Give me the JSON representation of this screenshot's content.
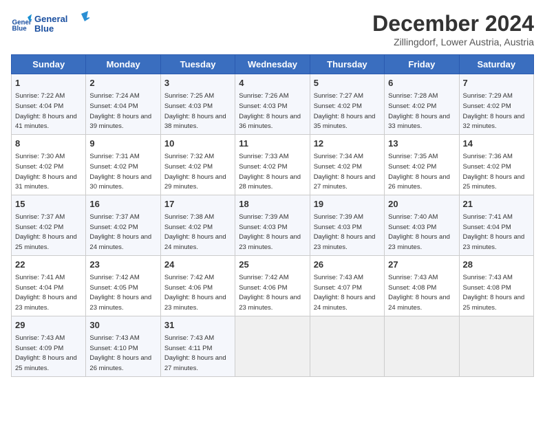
{
  "header": {
    "logo_line1": "General",
    "logo_line2": "Blue",
    "title": "December 2024",
    "subtitle": "Zillingdorf, Lower Austria, Austria"
  },
  "calendar": {
    "days_of_week": [
      "Sunday",
      "Monday",
      "Tuesday",
      "Wednesday",
      "Thursday",
      "Friday",
      "Saturday"
    ],
    "weeks": [
      [
        null,
        {
          "day": 2,
          "sunrise": "7:24 AM",
          "sunset": "4:04 PM",
          "daylight": "8 hours and 39 minutes."
        },
        {
          "day": 3,
          "sunrise": "7:25 AM",
          "sunset": "4:03 PM",
          "daylight": "8 hours and 38 minutes."
        },
        {
          "day": 4,
          "sunrise": "7:26 AM",
          "sunset": "4:03 PM",
          "daylight": "8 hours and 36 minutes."
        },
        {
          "day": 5,
          "sunrise": "7:27 AM",
          "sunset": "4:02 PM",
          "daylight": "8 hours and 35 minutes."
        },
        {
          "day": 6,
          "sunrise": "7:28 AM",
          "sunset": "4:02 PM",
          "daylight": "8 hours and 33 minutes."
        },
        {
          "day": 7,
          "sunrise": "7:29 AM",
          "sunset": "4:02 PM",
          "daylight": "8 hours and 32 minutes."
        }
      ],
      [
        {
          "day": 1,
          "sunrise": "7:22 AM",
          "sunset": "4:04 PM",
          "daylight": "8 hours and 41 minutes."
        },
        {
          "day": 9,
          "sunrise": "7:31 AM",
          "sunset": "4:02 PM",
          "daylight": "8 hours and 30 minutes."
        },
        {
          "day": 10,
          "sunrise": "7:32 AM",
          "sunset": "4:02 PM",
          "daylight": "8 hours and 29 minutes."
        },
        {
          "day": 11,
          "sunrise": "7:33 AM",
          "sunset": "4:02 PM",
          "daylight": "8 hours and 28 minutes."
        },
        {
          "day": 12,
          "sunrise": "7:34 AM",
          "sunset": "4:02 PM",
          "daylight": "8 hours and 27 minutes."
        },
        {
          "day": 13,
          "sunrise": "7:35 AM",
          "sunset": "4:02 PM",
          "daylight": "8 hours and 26 minutes."
        },
        {
          "day": 14,
          "sunrise": "7:36 AM",
          "sunset": "4:02 PM",
          "daylight": "8 hours and 25 minutes."
        }
      ],
      [
        {
          "day": 8,
          "sunrise": "7:30 AM",
          "sunset": "4:02 PM",
          "daylight": "8 hours and 31 minutes."
        },
        {
          "day": 16,
          "sunrise": "7:37 AM",
          "sunset": "4:02 PM",
          "daylight": "8 hours and 24 minutes."
        },
        {
          "day": 17,
          "sunrise": "7:38 AM",
          "sunset": "4:02 PM",
          "daylight": "8 hours and 24 minutes."
        },
        {
          "day": 18,
          "sunrise": "7:39 AM",
          "sunset": "4:03 PM",
          "daylight": "8 hours and 23 minutes."
        },
        {
          "day": 19,
          "sunrise": "7:39 AM",
          "sunset": "4:03 PM",
          "daylight": "8 hours and 23 minutes."
        },
        {
          "day": 20,
          "sunrise": "7:40 AM",
          "sunset": "4:03 PM",
          "daylight": "8 hours and 23 minutes."
        },
        {
          "day": 21,
          "sunrise": "7:41 AM",
          "sunset": "4:04 PM",
          "daylight": "8 hours and 23 minutes."
        }
      ],
      [
        {
          "day": 15,
          "sunrise": "7:37 AM",
          "sunset": "4:02 PM",
          "daylight": "8 hours and 25 minutes."
        },
        {
          "day": 23,
          "sunrise": "7:42 AM",
          "sunset": "4:05 PM",
          "daylight": "8 hours and 23 minutes."
        },
        {
          "day": 24,
          "sunrise": "7:42 AM",
          "sunset": "4:06 PM",
          "daylight": "8 hours and 23 minutes."
        },
        {
          "day": 25,
          "sunrise": "7:42 AM",
          "sunset": "4:06 PM",
          "daylight": "8 hours and 23 minutes."
        },
        {
          "day": 26,
          "sunrise": "7:43 AM",
          "sunset": "4:07 PM",
          "daylight": "8 hours and 24 minutes."
        },
        {
          "day": 27,
          "sunrise": "7:43 AM",
          "sunset": "4:08 PM",
          "daylight": "8 hours and 24 minutes."
        },
        {
          "day": 28,
          "sunrise": "7:43 AM",
          "sunset": "4:08 PM",
          "daylight": "8 hours and 25 minutes."
        }
      ],
      [
        {
          "day": 22,
          "sunrise": "7:41 AM",
          "sunset": "4:04 PM",
          "daylight": "8 hours and 23 minutes."
        },
        {
          "day": 30,
          "sunrise": "7:43 AM",
          "sunset": "4:10 PM",
          "daylight": "8 hours and 26 minutes."
        },
        {
          "day": 31,
          "sunrise": "7:43 AM",
          "sunset": "4:11 PM",
          "daylight": "8 hours and 27 minutes."
        },
        null,
        null,
        null,
        null
      ],
      [
        {
          "day": 29,
          "sunrise": "7:43 AM",
          "sunset": "4:09 PM",
          "daylight": "8 hours and 25 minutes."
        },
        null,
        null,
        null,
        null,
        null,
        null
      ]
    ]
  }
}
